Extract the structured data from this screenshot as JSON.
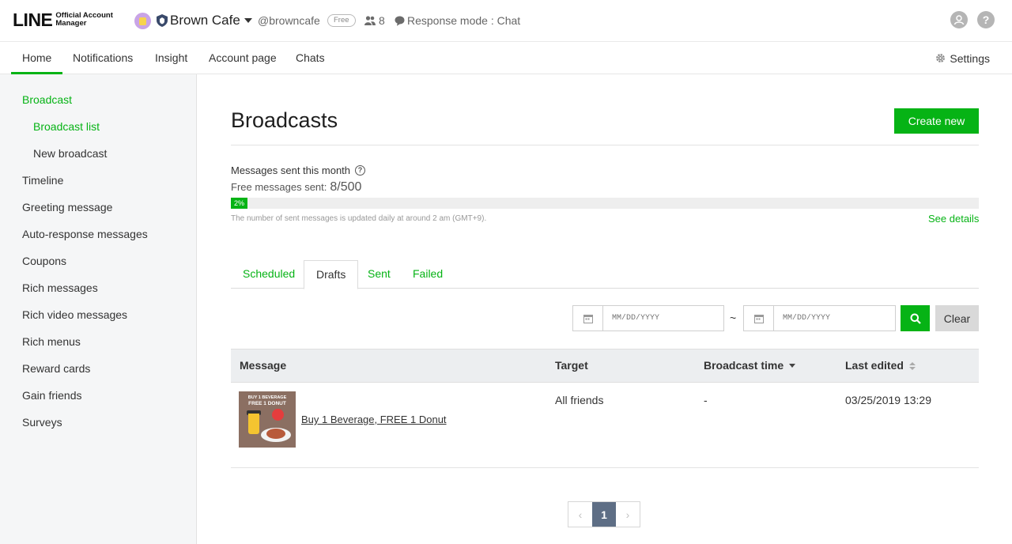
{
  "header": {
    "logo_main": "LINE",
    "logo_sub": "Official Account Manager",
    "account_name": "Brown Cafe",
    "handle": "@browncafe",
    "plan_badge": "Free",
    "friends_count": "8",
    "response_mode": "Response mode : Chat"
  },
  "nav": {
    "tabs": [
      {
        "label": "Home"
      },
      {
        "label": "Notifications"
      },
      {
        "label": "Insight"
      },
      {
        "label": "Account page"
      },
      {
        "label": "Chats"
      }
    ],
    "settings_label": "Settings"
  },
  "sidebar": {
    "items": [
      {
        "label": "Broadcast"
      },
      {
        "label": "Broadcast list"
      },
      {
        "label": "New broadcast"
      },
      {
        "label": "Timeline"
      },
      {
        "label": "Greeting message"
      },
      {
        "label": "Auto-response messages"
      },
      {
        "label": "Coupons"
      },
      {
        "label": "Rich messages"
      },
      {
        "label": "Rich video messages"
      },
      {
        "label": "Rich menus"
      },
      {
        "label": "Reward cards"
      },
      {
        "label": "Gain friends"
      },
      {
        "label": "Surveys"
      }
    ]
  },
  "main": {
    "title": "Broadcasts",
    "create_button": "Create new",
    "messages_label": "Messages sent this month",
    "free_label": "Free messages sent:",
    "free_count": "8/500",
    "progress_percent_label": "2%",
    "progress_fraction": 0.02,
    "note": "The number of sent messages is updated daily at around 2 am (GMT+9).",
    "see_details": "See details"
  },
  "tabs": [
    {
      "label": "Scheduled"
    },
    {
      "label": "Drafts"
    },
    {
      "label": "Sent"
    },
    {
      "label": "Failed"
    }
  ],
  "filters": {
    "date_placeholder": "MM/DD/YYYY",
    "tilde": "~",
    "clear": "Clear"
  },
  "table": {
    "headers": [
      "Message",
      "Target",
      "Broadcast time",
      "Last edited"
    ],
    "rows": [
      {
        "thumb_line1": "BUY 1 BEVERAGE",
        "thumb_line2": "FREE 1 DONUT",
        "title": "Buy 1 Beverage, FREE 1 Donut",
        "target": "All friends",
        "broadcast_time": "-",
        "last_edited": "03/25/2019 13:29"
      }
    ]
  },
  "pagination": {
    "current": "1",
    "prev": "‹",
    "next": "›"
  },
  "colors": {
    "accent": "#06b315",
    "pager_active": "#5e6e85"
  }
}
